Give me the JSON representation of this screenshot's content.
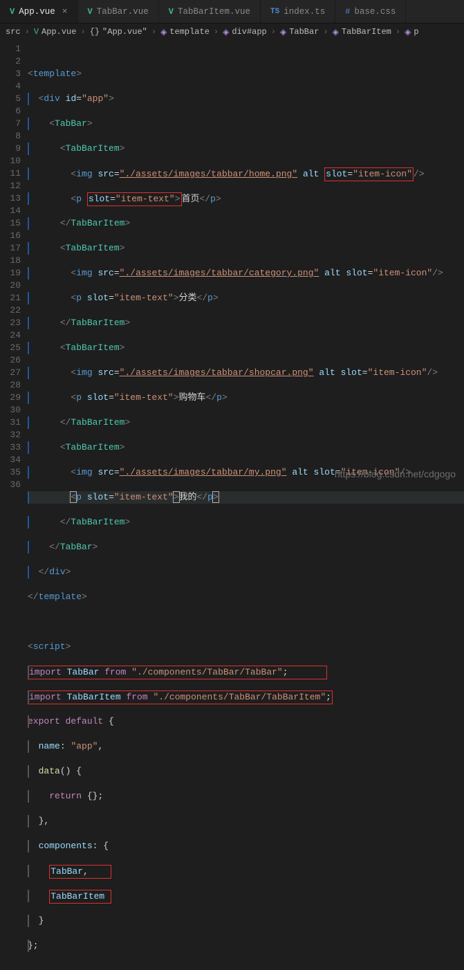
{
  "tabs": [
    {
      "label": "App.vue",
      "type": "vue",
      "active": true,
      "closeable": true
    },
    {
      "label": "TabBar.vue",
      "type": "vue",
      "active": false,
      "closeable": false
    },
    {
      "label": "TabBarItem.vue",
      "type": "vue",
      "active": false,
      "closeable": false
    },
    {
      "label": "index.ts",
      "type": "ts",
      "active": false,
      "closeable": false
    },
    {
      "label": "base.css",
      "type": "css",
      "active": false,
      "closeable": false
    }
  ],
  "breadcrumb": {
    "items": [
      {
        "icon": "",
        "label": "src"
      },
      {
        "icon": "vue",
        "label": "App.vue"
      },
      {
        "icon": "braces",
        "label": "\"App.vue\""
      },
      {
        "icon": "cube",
        "label": "template"
      },
      {
        "icon": "cube",
        "label": "div#app"
      },
      {
        "icon": "cube",
        "label": "TabBar"
      },
      {
        "icon": "cube",
        "label": "TabBarItem"
      },
      {
        "icon": "cube",
        "label": "p"
      }
    ]
  },
  "code": {
    "line_count": 36,
    "current_line": 18,
    "tag_template": "template",
    "tag_div": "div",
    "attr_id": "id",
    "val_app": "\"app\"",
    "tag_tabbar": "TabBar",
    "tag_tabbaritem": "TabBarItem",
    "tag_img": "img",
    "tag_p": "p",
    "attr_src": "src",
    "attr_alt": "alt",
    "attr_slot": "slot",
    "val_item_icon": "\"item-icon\"",
    "val_item_text": "\"item-text\"",
    "src_home": "\"./assets/images/tabbar/home.png\"",
    "src_category": "\"./assets/images/tabbar/category.png\"",
    "src_shopcar": "\"./assets/images/tabbar/shopcar.png\"",
    "src_my": "\"./assets/images/tabbar/my.png\"",
    "txt_home": "首页",
    "txt_category": "分类",
    "txt_shopcar": "购物车",
    "txt_my": "我的",
    "tag_script": "script",
    "kw_import": "import",
    "kw_from": "from",
    "kw_export": "export",
    "kw_default": "default",
    "kw_return": "return",
    "id_tabbar": "TabBar",
    "id_tabbaritem": "TabBarItem",
    "str_tabbar_path": "\"./components/TabBar/TabBar\"",
    "str_tabbaritem_path": "\"./components/TabBar/TabBarItem\"",
    "prop_name": "name",
    "val_name": "\"app\"",
    "fn_data": "data",
    "prop_components": "components"
  },
  "watermark": "https://blog.csdn.net/cdgogo"
}
